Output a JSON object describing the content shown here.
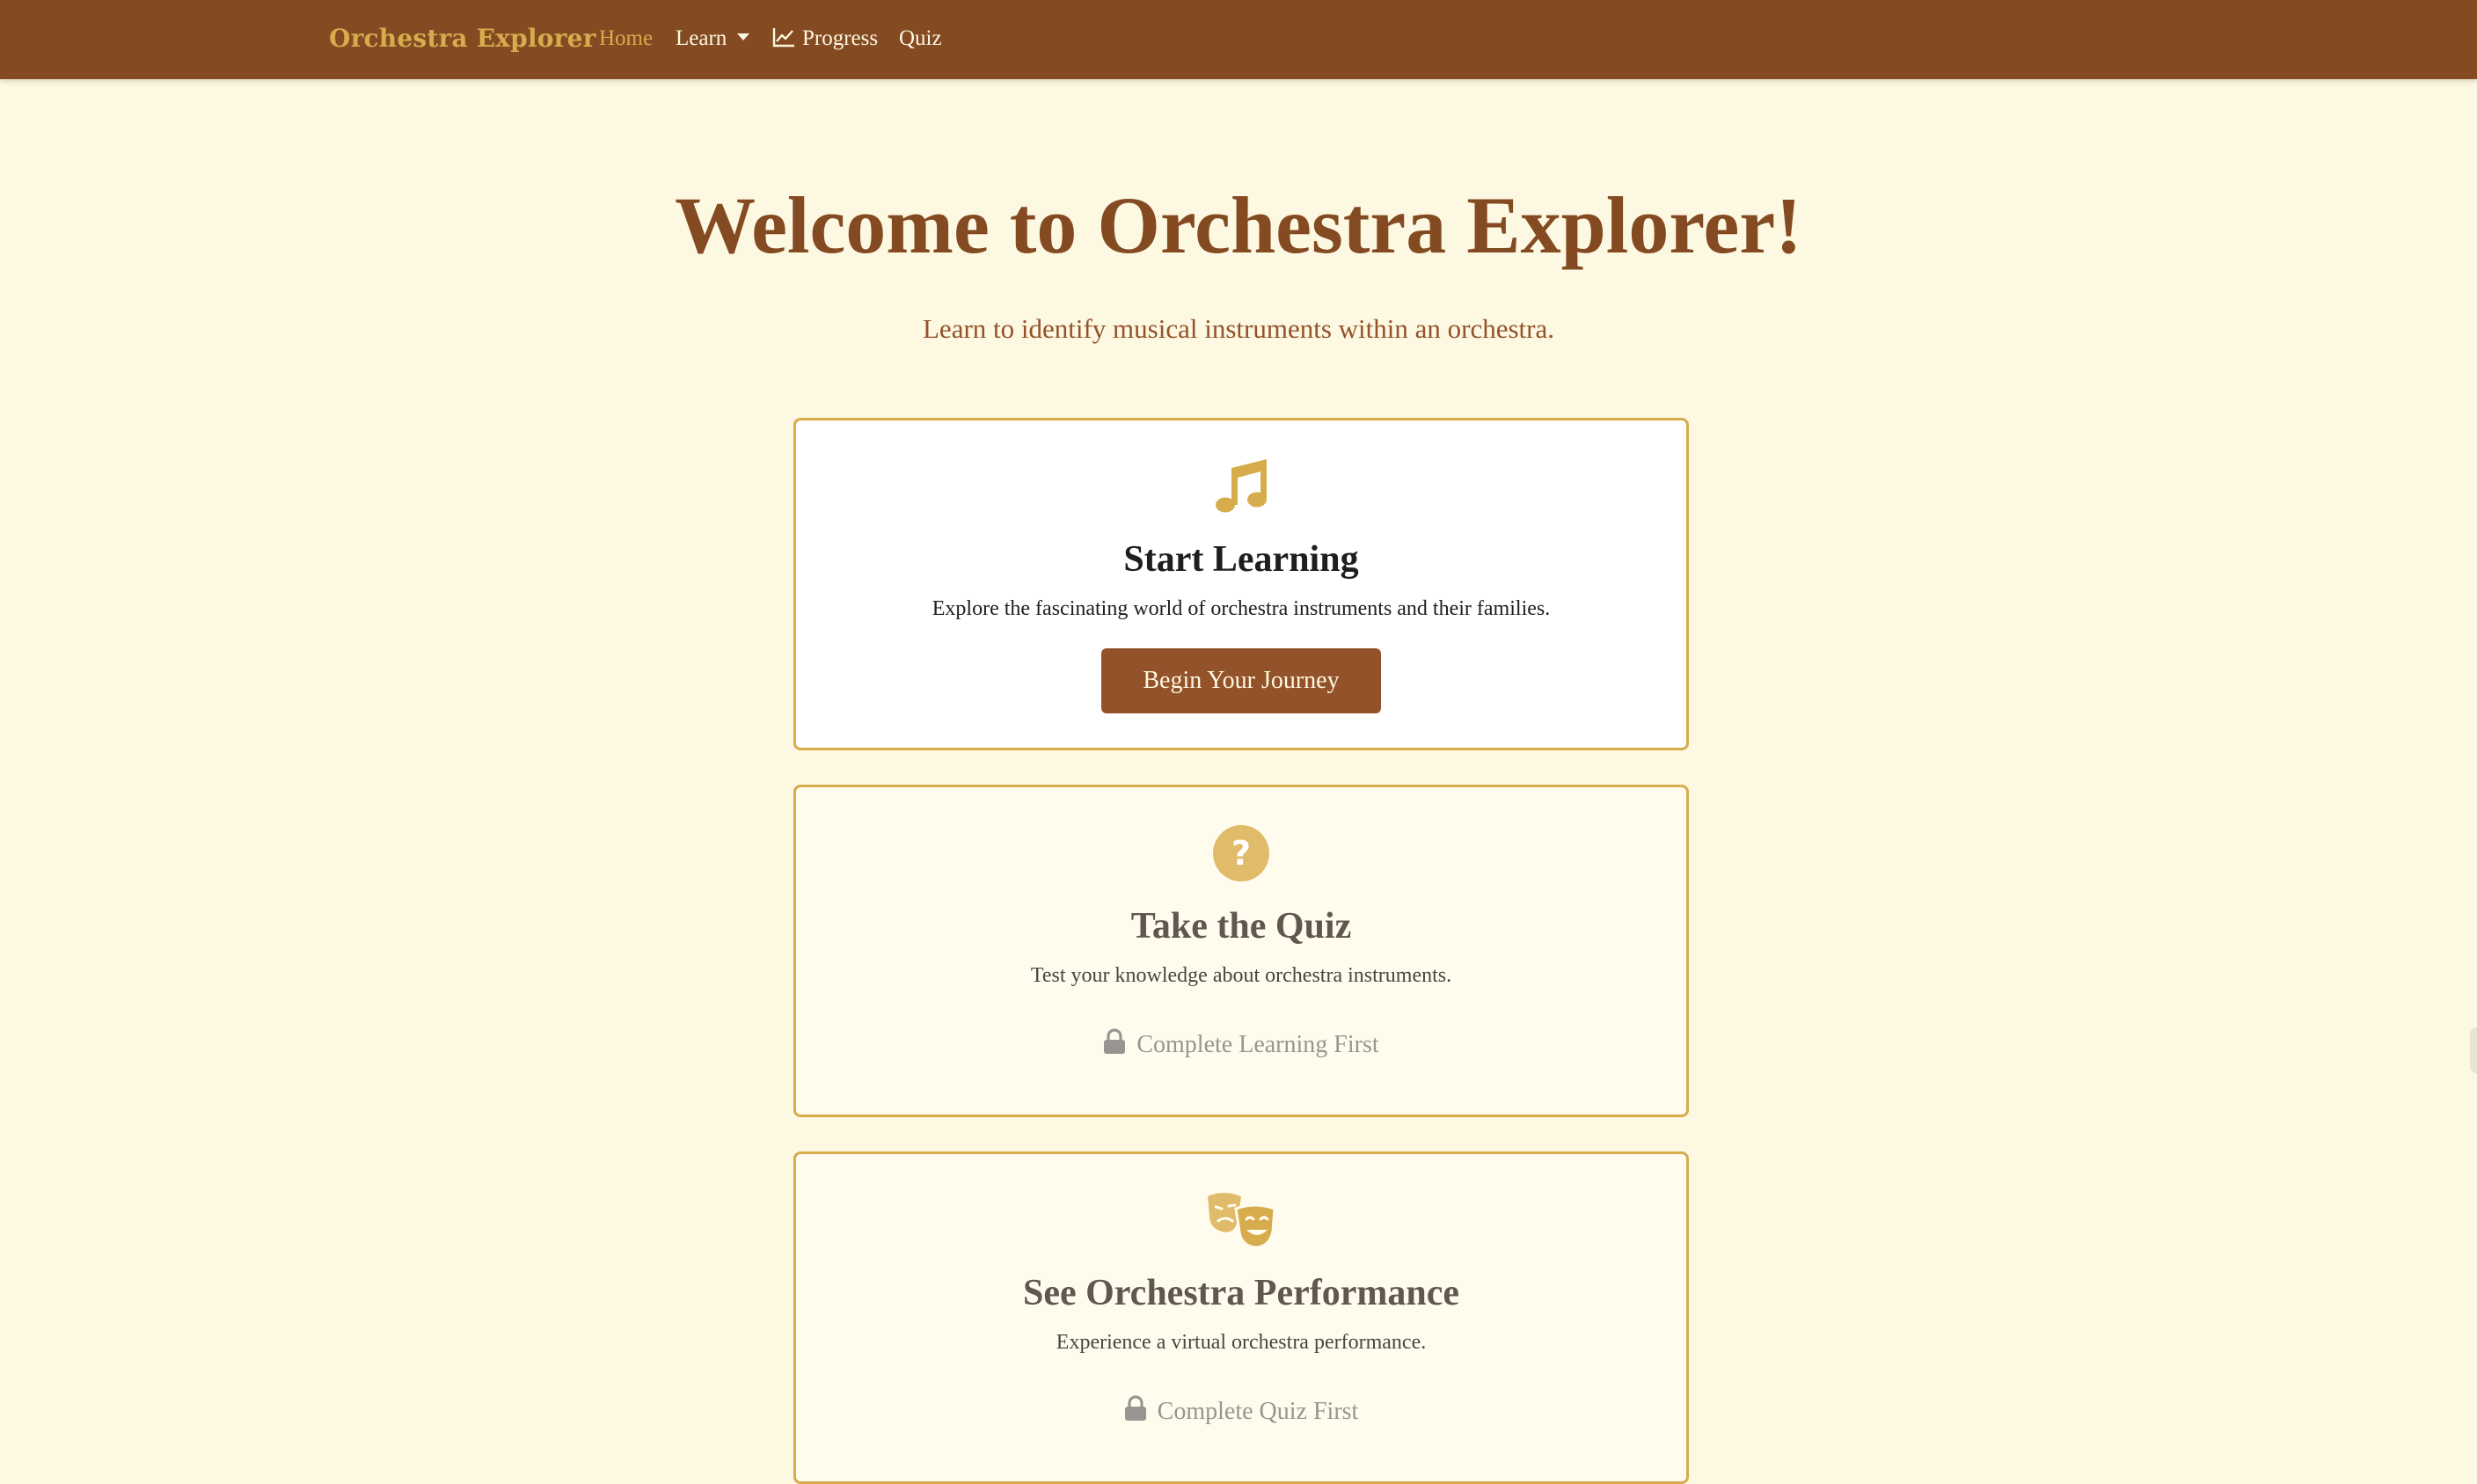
{
  "navbar": {
    "brand": "Orchestra Explorer",
    "items": [
      {
        "label": "Home",
        "active": true
      },
      {
        "label": "Learn",
        "has_dropdown": true
      },
      {
        "label": "Progress",
        "icon": "chart-line-icon"
      },
      {
        "label": "Quiz"
      }
    ]
  },
  "hero": {
    "title": "Welcome to Orchestra Explorer!",
    "subtitle": "Learn to identify musical instruments within an orchestra."
  },
  "cards": [
    {
      "icon": "music-note-icon",
      "title": "Start Learning",
      "text": "Explore the fascinating world of orchestra instruments and their families.",
      "button_label": "Begin Your Journey",
      "locked": false
    },
    {
      "icon": "question-circle-icon",
      "title": "Take the Quiz",
      "text": "Test your knowledge about orchestra instruments.",
      "locked_label": "Complete Learning First",
      "locked": true
    },
    {
      "icon": "theater-masks-icon",
      "title": "See Orchestra Performance",
      "text": "Experience a virtual orchestra performance.",
      "locked_label": "Complete Quiz First",
      "locked": true
    }
  ],
  "colors": {
    "navbar_bg": "#844a22",
    "accent_gold": "#d6ac4d",
    "page_bg": "#fdf8e1",
    "button_bg": "#93522a",
    "heading_brown": "#844a22"
  }
}
